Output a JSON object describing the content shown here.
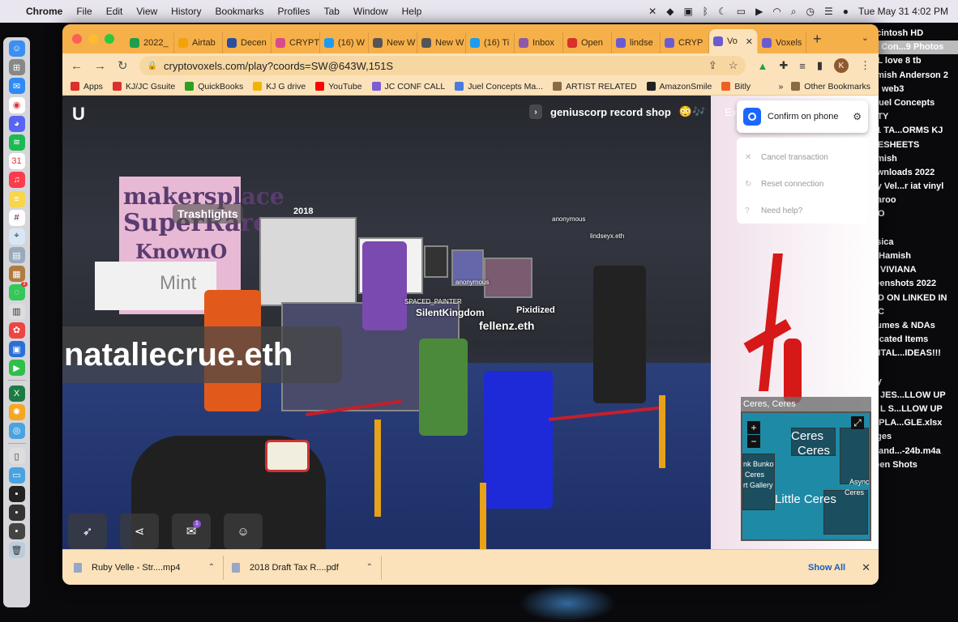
{
  "menubar": {
    "app": "Chrome",
    "items": [
      "File",
      "Edit",
      "View",
      "History",
      "Bookmarks",
      "Profiles",
      "Tab",
      "Window",
      "Help"
    ],
    "datetime": "Tue May 31  4:02 PM"
  },
  "tabs": [
    {
      "label": "2022_",
      "color": "#1e9e4a"
    },
    {
      "label": "Airtab",
      "color": "#f2a30a"
    },
    {
      "label": "Decen",
      "color": "#2a4fa0"
    },
    {
      "label": "CRYPT",
      "color": "#d84a8c"
    },
    {
      "label": "(16) W",
      "color": "#1d9bf0"
    },
    {
      "label": "New W",
      "color": "#555555"
    },
    {
      "label": "New W",
      "color": "#555555"
    },
    {
      "label": "(16) Ti",
      "color": "#1d9bf0"
    },
    {
      "label": "Inbox",
      "color": "#8e5aa8"
    },
    {
      "label": "Open",
      "color": "#d9312b"
    },
    {
      "label": "lindse",
      "color": "#6a5bd0"
    },
    {
      "label": "CRYP",
      "color": "#6a5bd0"
    },
    {
      "label": "Vo",
      "color": "#6a5bd0",
      "active": true
    },
    {
      "label": "Voxels",
      "color": "#6a5bd0"
    }
  ],
  "address": {
    "url": "cryptovoxels.com/play?coords=SW@643W,151S"
  },
  "bookmarks": {
    "items": [
      {
        "label": "Apps",
        "color": "#d9312b"
      },
      {
        "label": "KJ/JC Gsuite",
        "color": "#d9312b"
      },
      {
        "label": "QuickBooks",
        "color": "#2ca01c"
      },
      {
        "label": "KJ G drive",
        "color": "#f2b400"
      },
      {
        "label": "YouTube",
        "color": "#ff0000"
      },
      {
        "label": "JC CONF CALL",
        "color": "#7b5bd6"
      },
      {
        "label": "Juel Concepts Ma...",
        "color": "#4a7be0"
      },
      {
        "label": "ARTIST RELATED",
        "color": "#8a6b46"
      },
      {
        "label": "AmazonSmile",
        "color": "#222222"
      },
      {
        "label": "Bitly",
        "color": "#ee6123"
      }
    ],
    "other": "Other Bookmarks",
    "overflow": "»"
  },
  "scene": {
    "location": "geniuscorp record shop",
    "location_emoji": "😳🎶",
    "explore": "Explore",
    "big_nametag": "nataliecrue.eth",
    "trashlights": "Trashlights",
    "sign_makers": "makersplace",
    "sign_superrare": "SuperRare",
    "sign_known": "KnownO",
    "sign_mint": "Mint",
    "sign_year": "2018",
    "names": {
      "anonymous_top": "anonymous",
      "lindseyx": "lindseyx.eth",
      "anonymous_mid": "anonymous",
      "spaced": "SPACED_PAINTER",
      "silent": "SilentKingdom",
      "pixidized": "Pixidized",
      "fellenz": "fellenz.eth"
    },
    "chat_badge": "1"
  },
  "wallet": {
    "confirm": "Confirm on phone",
    "menu": [
      "Cancel transaction",
      "Reset connection",
      "Need help?"
    ]
  },
  "minimap": {
    "title": "Ceres, Ceres",
    "big1": "Ceres",
    "big2": "Ceres",
    "little": "Little Ceres",
    "labels": [
      "nk Bunko",
      "Ceres",
      "rt Gallery",
      "Async",
      "Ceres"
    ]
  },
  "downloads": {
    "items": [
      "Ruby Velle - Str....mp4",
      "2018 Draft Tax R....pdf"
    ],
    "show_all": "Show All"
  },
  "desktop": {
    "files": [
      "acintosh HD",
      "el Con...9 Photos",
      "EL love 8 tb",
      "amish Anderson 2",
      "m web3",
      "/Juel Concepts",
      "STY",
      "21 TA...ORMS KJ",
      "NESHEETS",
      "amish",
      "ownloads 2022",
      "by Vel...r iat vinyl",
      "garoo",
      "DO",
      "S",
      "ssica",
      "a Hamish",
      "R VIVIANA",
      "reenshots 2022",
      "ND ON LINKED IN",
      "NC",
      "sumes & NDAs",
      "located Items",
      "GITAL...IDEAS!!!",
      "C",
      "by",
      "R JES...LLOW UP",
      "R L S...LLOW UP",
      "MPLA...GLE.xlsx",
      "ages",
      "a and...-24b.m4a",
      "reen Shots"
    ]
  }
}
